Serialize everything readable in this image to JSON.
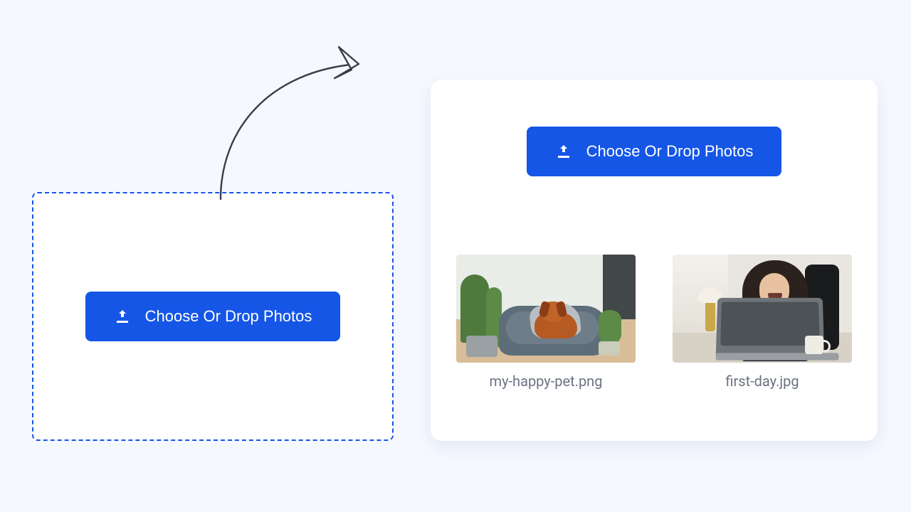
{
  "colors": {
    "accent": "#1556e6",
    "background": "#f5f8ff"
  },
  "left_panel": {
    "upload_button_label": "Choose Or Drop Photos"
  },
  "right_panel": {
    "upload_button_label": "Choose Or Drop Photos",
    "files": [
      {
        "filename": "my-happy-pet.png",
        "alt": "dog on a blue pet bed"
      },
      {
        "filename": "first-day.jpg",
        "alt": "woman laughing at a laptop"
      }
    ]
  }
}
